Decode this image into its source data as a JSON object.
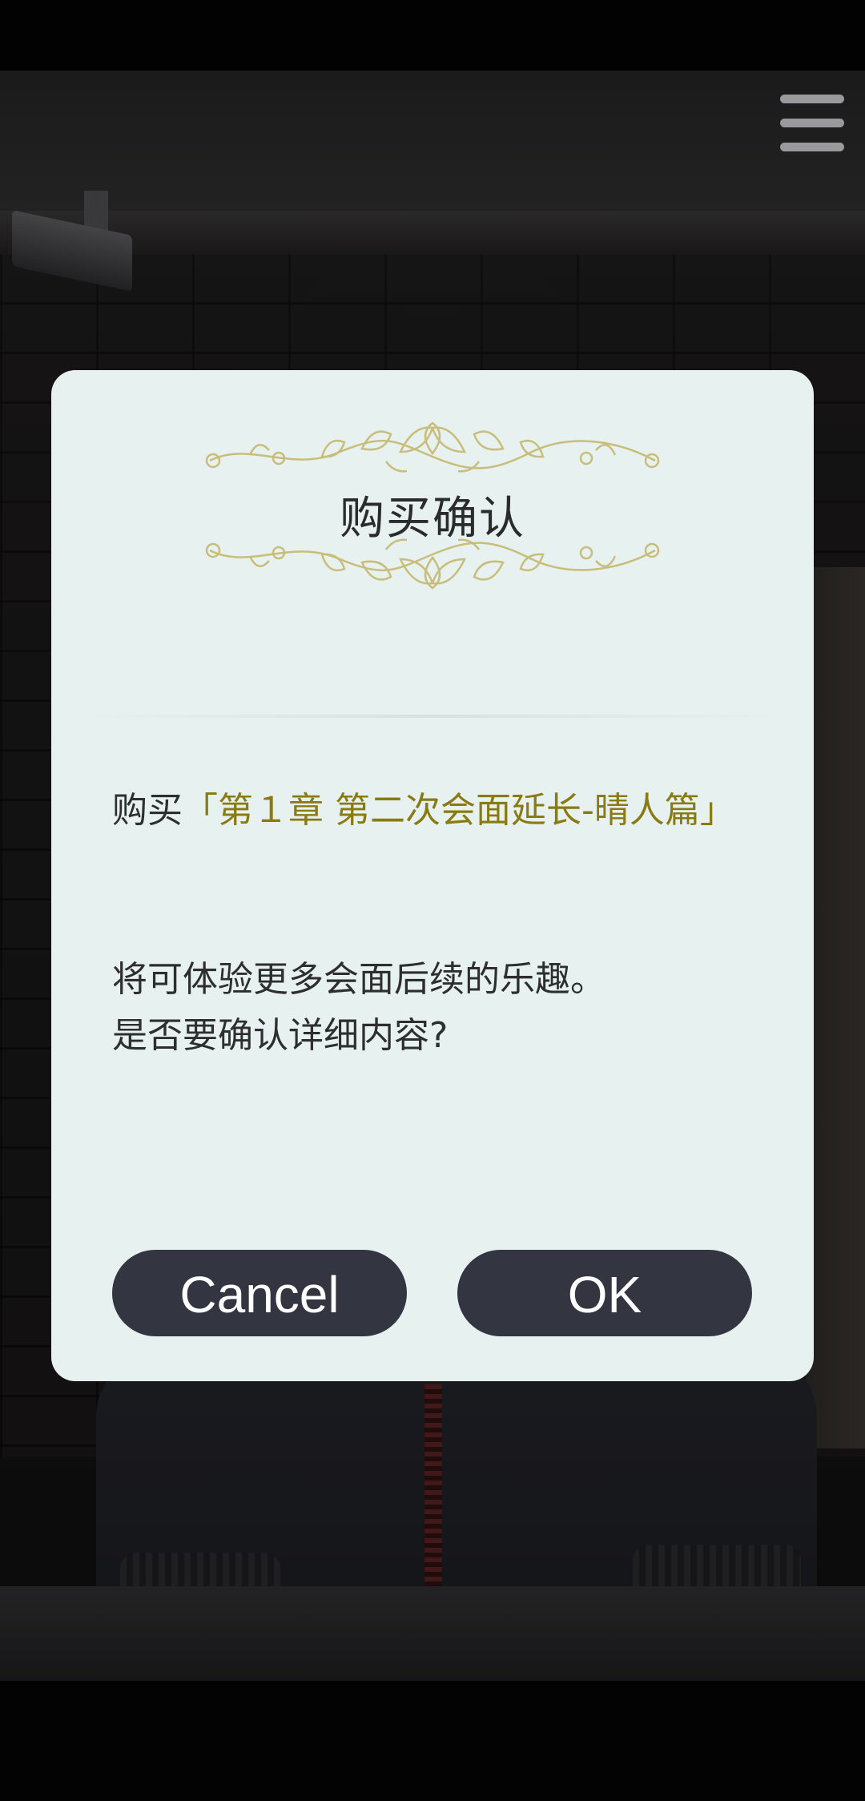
{
  "dialog": {
    "title": "购买确认",
    "purchase_prefix": "购买",
    "purchase_item": "「第１章 第二次会面延长-晴人篇」",
    "body_line1": "将可体验更多会面后续的乐趣。",
    "body_line2": "是否要确认详细内容?",
    "cancel_label": "Cancel",
    "ok_label": "OK"
  },
  "colors": {
    "dialog_bg": "#e7f2f0",
    "button_bg": "#333541",
    "item_highlight": "#8a7a14",
    "ornament": "#c8bd7a"
  },
  "icons": {
    "menu": "hamburger-menu-icon",
    "ornament": "vine-ornament-icon"
  }
}
